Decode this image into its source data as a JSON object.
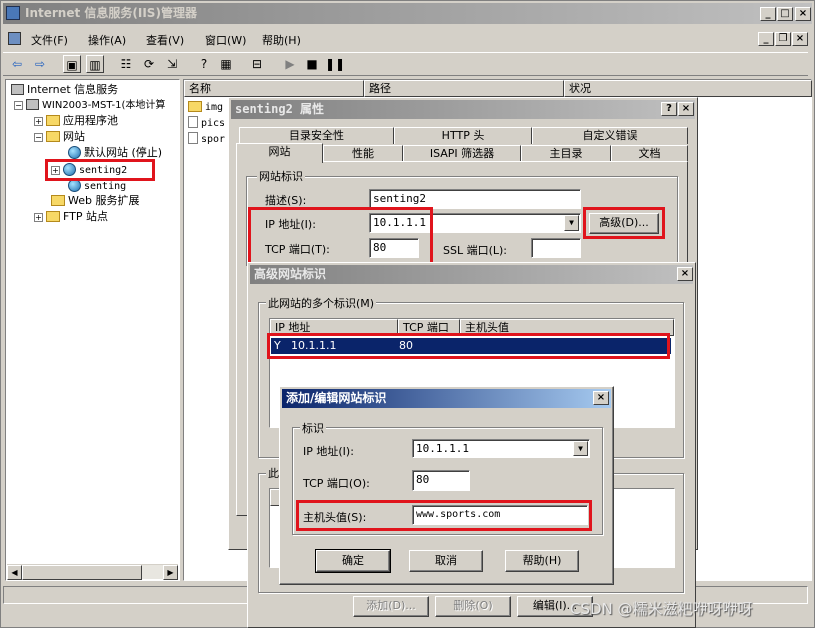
{
  "main_window": {
    "title": "Internet 信息服务(IIS)管理器",
    "menu": [
      "文件(F)",
      "操作(A)",
      "查看(V)",
      "窗口(W)",
      "帮助(H)"
    ]
  },
  "tree": {
    "root": "Internet 信息服务",
    "server": "WIN2003-MST-1(本地计算",
    "app_pool": "应用程序池",
    "websites": "网站",
    "default_site": "默认网站 (停止)",
    "site_senting2": "senting2",
    "site_senting": "senting",
    "web_ext": "Web 服务扩展",
    "ftp": "FTP 站点"
  },
  "list": {
    "columns": [
      "名称",
      "路径",
      "状况"
    ],
    "items": [
      "img",
      "pics",
      "spor"
    ]
  },
  "props_dialog": {
    "title": "senting2 属性",
    "tabs_row1": [
      "目录安全性",
      "HTTP 头",
      "自定义错误"
    ],
    "tabs_row2": [
      "网站",
      "性能",
      "ISAPI 筛选器",
      "主目录",
      "文档"
    ],
    "group_title": "网站标识",
    "desc_label": "描述(S):",
    "desc_value": "senting2",
    "ip_label": "IP 地址(I):",
    "ip_value": "10.1.1.1",
    "tcp_label": "TCP 端口(T):",
    "tcp_value": "80",
    "ssl_label": "SSL 端口(L):",
    "ssl_value": "",
    "advanced_button": "高级(D)..."
  },
  "advanced_dialog": {
    "title": "高级网站标识",
    "group_title": "此网站的多个标识(M)",
    "columns": [
      "IP 地址",
      "TCP 端口",
      "主机头值"
    ],
    "rows": [
      {
        "ip": "10.1.1.1",
        "port": "80",
        "host": ""
      }
    ],
    "group2_title": "此",
    "add_button": "添加(D)...",
    "remove_button": "删除(O)",
    "edit_button": "编辑(I)..."
  },
  "edit_dialog": {
    "title": "添加/编辑网站标识",
    "group_title": "标识",
    "ip_label": "IP 地址(I):",
    "ip_value": "10.1.1.1",
    "tcp_label": "TCP 端口(O):",
    "tcp_value": "80",
    "host_label": "主机头值(S):",
    "host_value": "www.sports.com",
    "ok_button": "确定",
    "cancel_button": "取消",
    "help_button": "帮助(H)"
  },
  "watermark": "CSDN @糯米滋粑咿呀咿呀",
  "colors": {
    "highlight": "#e0141c",
    "selection": "#0a246a",
    "face": "#d4d0c8"
  }
}
